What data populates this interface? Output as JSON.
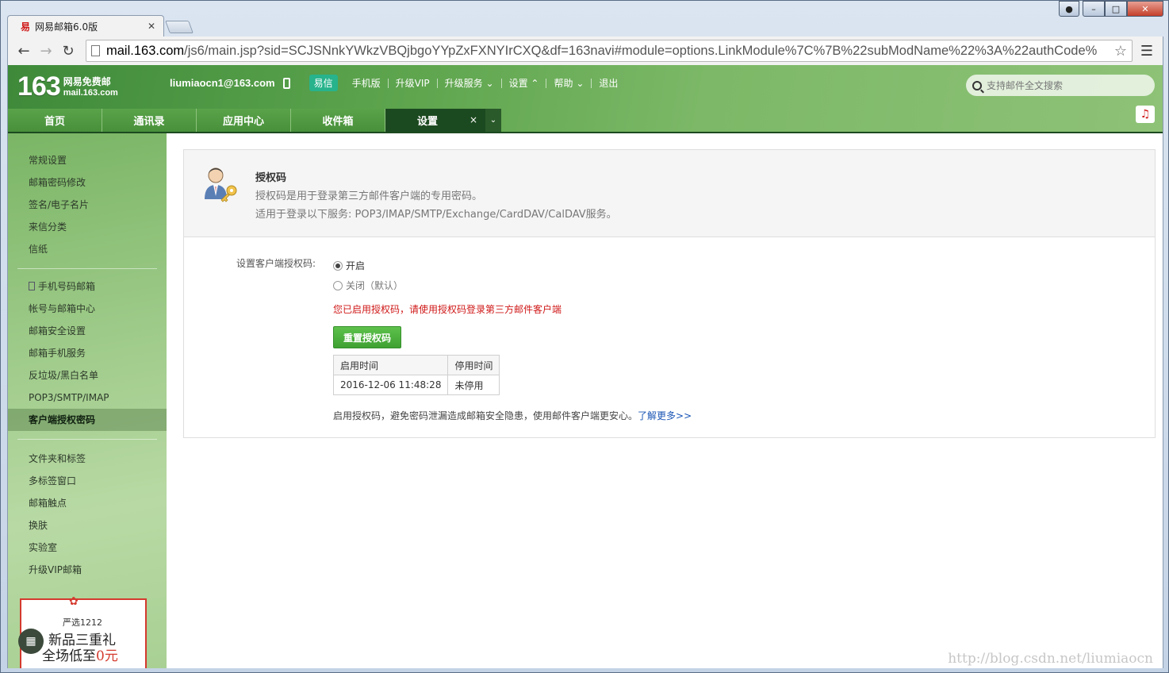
{
  "browser": {
    "tab_title": "网易邮箱6.0版",
    "tab_favicon": "易",
    "url_host": "mail.163.com",
    "url_rest": "/js6/main.jsp?sid=SCJSNnkYWkzVBQjbgoYYpZxFXNYIrCXQ&df=163navi#module=options.LinkModule%7C%7B%22subModName%22%3A%22authCode%"
  },
  "header": {
    "logo_number": "163",
    "logo_line1": "网易免费邮",
    "logo_line2": "mail.163.com",
    "account": "liumiaocn1@163.com",
    "yixin": "易信",
    "links": [
      "手机版",
      "升级VIP",
      "升级服务",
      "设置",
      "帮助",
      "退出"
    ],
    "search_placeholder": "支持邮件全文搜索"
  },
  "nav": {
    "items": [
      "首页",
      "通讯录",
      "应用中心",
      "收件箱"
    ],
    "active": "设置",
    "close": "×",
    "more": "⌄"
  },
  "sidebar": {
    "group1": [
      "常规设置",
      "邮箱密码修改",
      "签名/电子名片",
      "来信分类",
      "信纸"
    ],
    "group2": [
      "手机号码邮箱",
      "帐号与邮箱中心",
      "邮箱安全设置",
      "邮箱手机服务",
      "反垃圾/黑白名单",
      "POP3/SMTP/IMAP",
      "客户端授权密码"
    ],
    "group3": [
      "文件夹和标签",
      "多标签窗口",
      "邮箱触点",
      "换肤",
      "实验室",
      "升级VIP邮箱"
    ],
    "promo": {
      "line1": "严选1212",
      "line2": "新品三重礼",
      "line3a": "全场低至",
      "line3b": "0元"
    }
  },
  "content": {
    "title": "授权码",
    "desc1": "授权码是用于登录第三方邮件客户端的专用密码。",
    "desc2": "适用于登录以下服务: POP3/IMAP/SMTP/Exchange/CardDAV/CalDAV服务。",
    "form_label": "设置客户端授权码:",
    "radio_on": "开启",
    "radio_off": "关闭（默认）",
    "notice": "您已启用授权码，请使用授权码登录第三方邮件客户端",
    "reset_button": "重置授权码",
    "table_headers": [
      "启用时间",
      "停用时间"
    ],
    "table_row": [
      "2016-12-06 11:48:28",
      "未停用"
    ],
    "tip_text": "启用授权码，避免密码泄漏造成邮箱安全隐患，使用邮件客户端更安心。",
    "tip_link": "了解更多>>"
  },
  "watermark": "http://blog.csdn.net/liumiaocn",
  "colors": {
    "accent_green": "#48903a",
    "dark_green": "#1c4a20",
    "notice_red": "#d01818",
    "link_blue": "#1a55b5"
  }
}
